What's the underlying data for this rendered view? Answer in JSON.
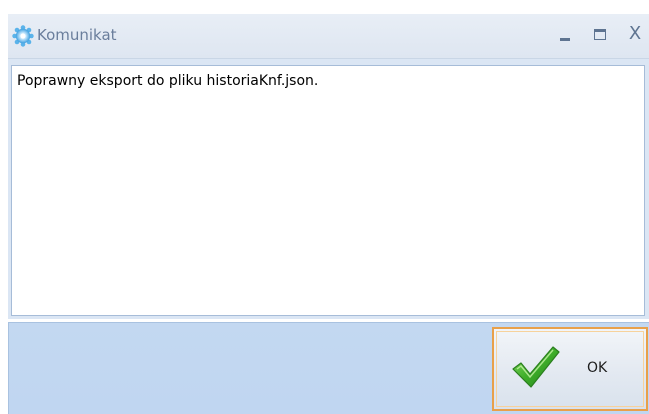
{
  "window": {
    "title": "Komunikat",
    "icon": "app-gear-icon",
    "controls": {
      "minimize": "minimize-icon",
      "maximize": "maximize-icon",
      "close": "X"
    }
  },
  "message": {
    "text": "Poprawny eksport do pliku historiaKnf.json."
  },
  "buttons": {
    "ok_label": "OK",
    "ok_icon": "checkmark-icon"
  },
  "colors": {
    "titlebar": "#dee6f1",
    "panel": "#c0d6f1",
    "ok_border": "#e8a04a",
    "check_green": "#3fae2a"
  }
}
